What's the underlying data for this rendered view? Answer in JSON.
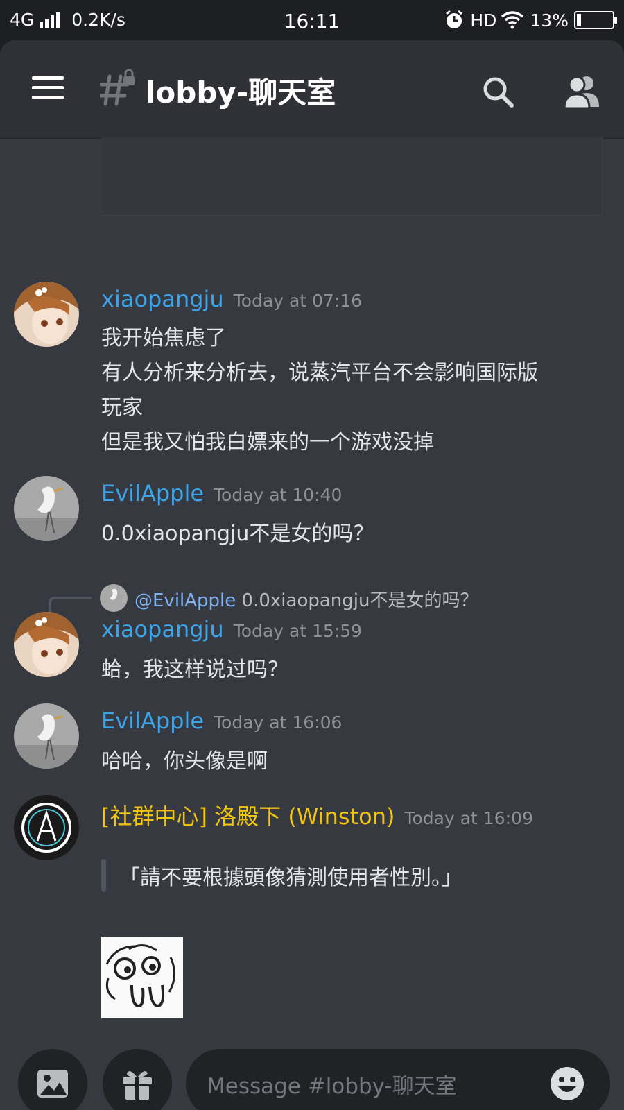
{
  "status_bar": {
    "network": "4G",
    "speed": "0.2K/s",
    "time": "16:11",
    "hd": "HD",
    "battery": "13%"
  },
  "header": {
    "channel_name": "lobby-聊天室",
    "icons": [
      "menu-icon",
      "locked-channel-hash-icon",
      "search-icon",
      "members-icon"
    ]
  },
  "messages": [
    {
      "author": "xiaopangju",
      "timestamp": "Today at 07:16",
      "lines": [
        "我开始焦虑了",
        "有人分析来分析去，说蒸汽平台不会影响国际版",
        "玩家",
        "但是我又怕我白嫖来的一个游戏没掉"
      ]
    },
    {
      "author": "EvilApple",
      "timestamp": "Today at 10:40",
      "lines": [
        "0.0xiaopangju不是女的吗？"
      ]
    },
    {
      "reply": {
        "mention": "@EvilApple",
        "text": "0.0xiaopangju不是女的吗？"
      },
      "author": "xiaopangju",
      "timestamp": "Today at 15:59",
      "lines": [
        "蛤，我这样说过吗？"
      ]
    },
    {
      "author": "EvilApple",
      "timestamp": "Today at 16:06",
      "lines": [
        "哈哈，你头像是啊"
      ]
    },
    {
      "author": "[社群中心] 洛殿下 (Winston)",
      "timestamp": "Today at 16:09",
      "quote": "「請不要根據頭像猜測使用者性別。」",
      "attachment": "sticker-image"
    }
  ],
  "composer": {
    "placeholder": "Message #lobby-聊天室",
    "icons": [
      "image-icon",
      "gift-icon",
      "emoji-icon"
    ]
  },
  "colors": {
    "username_blue": "#3ea3e7",
    "username_gold": "#f1c40f",
    "background": "#36393f",
    "header": "#2f3136"
  }
}
